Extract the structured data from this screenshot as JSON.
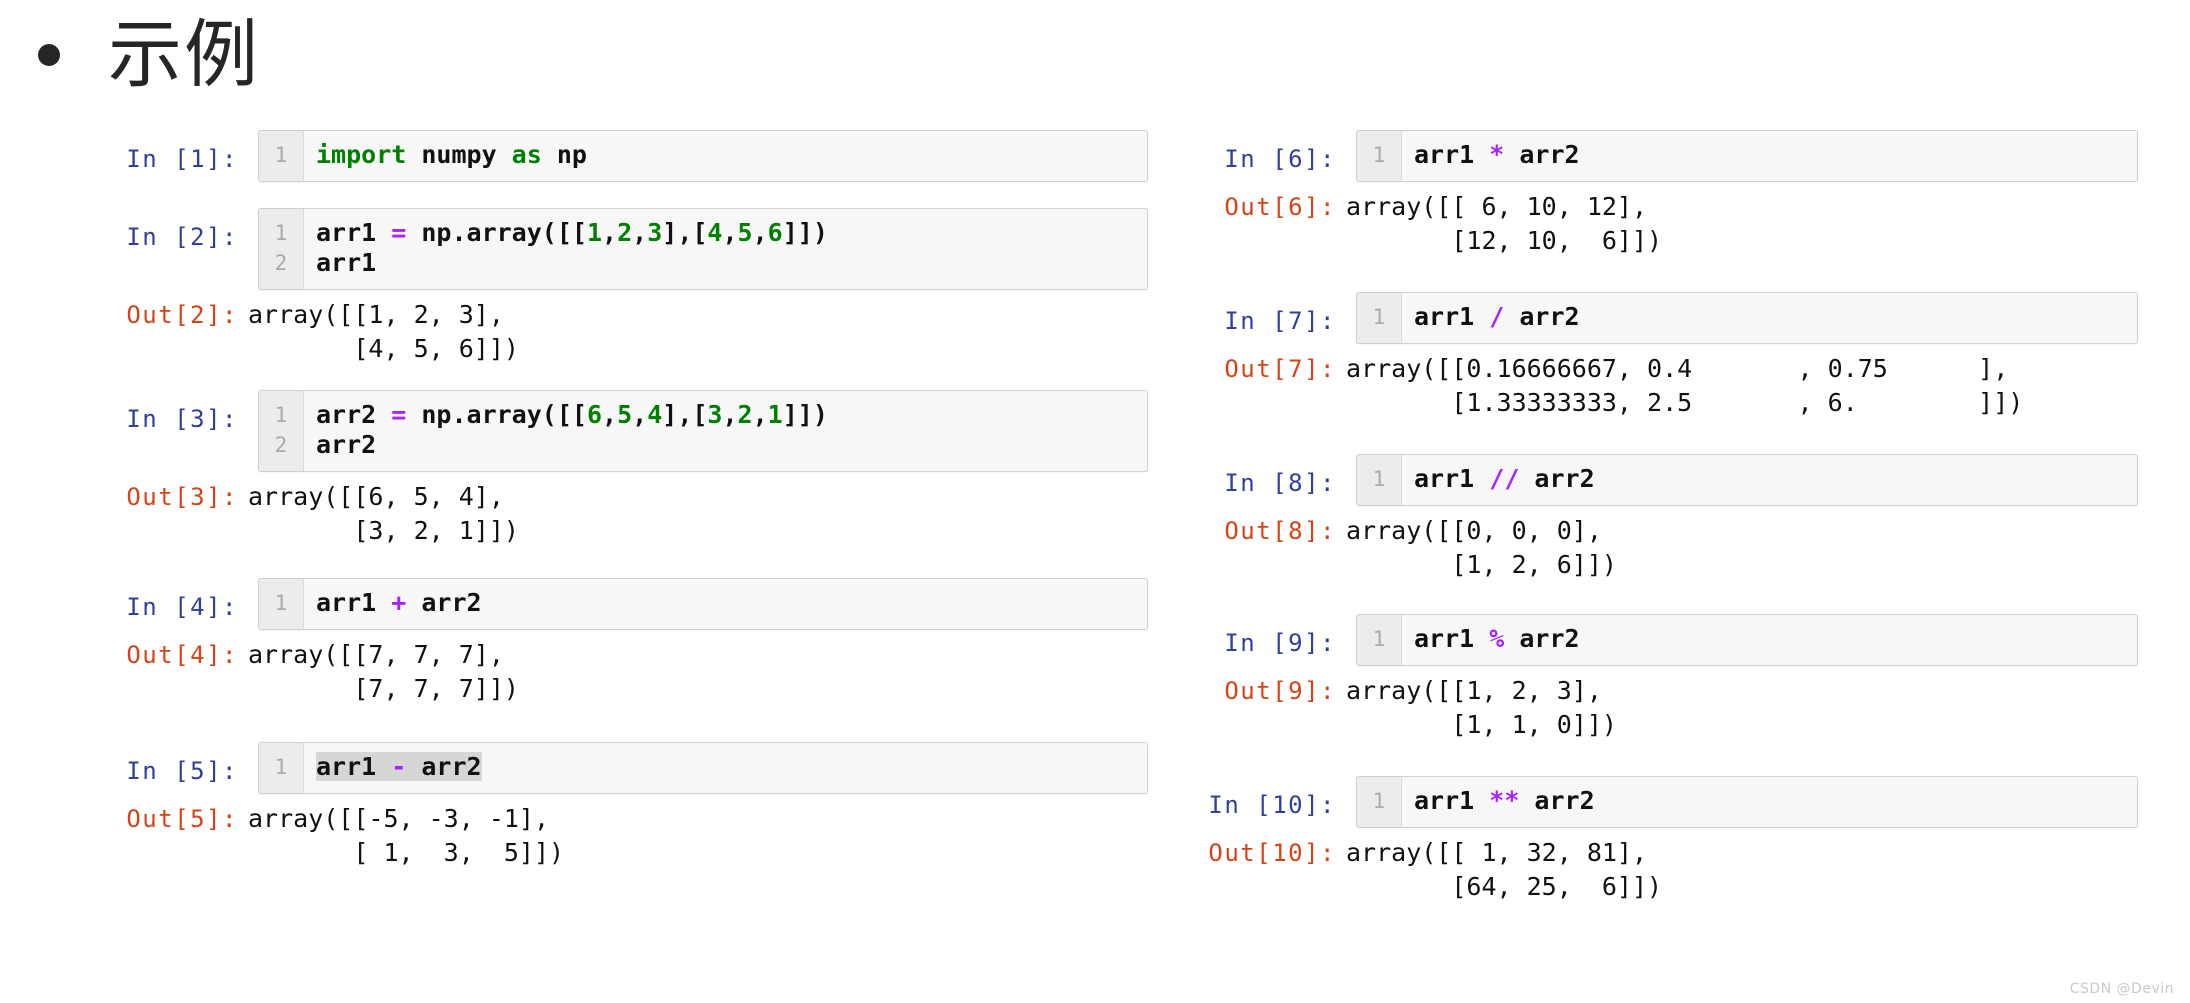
{
  "slide": {
    "bullet_glyph": "•",
    "title": "示例",
    "watermark": "CSDN @Devin"
  },
  "left_column": [
    {
      "in_prompt": "In [1]:",
      "line_numbers": "1",
      "code_tokens": [
        [
          {
            "t": "import",
            "c": "kw"
          },
          {
            "t": " numpy ",
            "c": ""
          },
          {
            "t": "as",
            "c": "kw"
          },
          {
            "t": " np",
            "c": ""
          }
        ]
      ],
      "out_prompt": null,
      "out_text": null
    },
    {
      "in_prompt": "In [2]:",
      "line_numbers": "1\n2",
      "code_tokens": [
        [
          {
            "t": "arr1 ",
            "c": ""
          },
          {
            "t": "=",
            "c": "op"
          },
          {
            "t": " np.array([[",
            "c": ""
          },
          {
            "t": "1",
            "c": "num"
          },
          {
            "t": ",",
            "c": ""
          },
          {
            "t": "2",
            "c": "num"
          },
          {
            "t": ",",
            "c": ""
          },
          {
            "t": "3",
            "c": "num"
          },
          {
            "t": "],[",
            "c": ""
          },
          {
            "t": "4",
            "c": "num"
          },
          {
            "t": ",",
            "c": ""
          },
          {
            "t": "5",
            "c": "num"
          },
          {
            "t": ",",
            "c": ""
          },
          {
            "t": "6",
            "c": "num"
          },
          {
            "t": "]])",
            "c": ""
          }
        ],
        [
          {
            "t": "arr1",
            "c": ""
          }
        ]
      ],
      "out_prompt": "Out[2]:",
      "out_text": "array([[1, 2, 3],\n       [4, 5, 6]])"
    },
    {
      "in_prompt": "In [3]:",
      "line_numbers": "1\n2",
      "code_tokens": [
        [
          {
            "t": "arr2 ",
            "c": ""
          },
          {
            "t": "=",
            "c": "op"
          },
          {
            "t": " np.array([[",
            "c": ""
          },
          {
            "t": "6",
            "c": "num"
          },
          {
            "t": ",",
            "c": ""
          },
          {
            "t": "5",
            "c": "num"
          },
          {
            "t": ",",
            "c": ""
          },
          {
            "t": "4",
            "c": "num"
          },
          {
            "t": "],[",
            "c": ""
          },
          {
            "t": "3",
            "c": "num"
          },
          {
            "t": ",",
            "c": ""
          },
          {
            "t": "2",
            "c": "num"
          },
          {
            "t": ",",
            "c": ""
          },
          {
            "t": "1",
            "c": "num"
          },
          {
            "t": "]])",
            "c": ""
          }
        ],
        [
          {
            "t": "arr2",
            "c": ""
          }
        ]
      ],
      "out_prompt": "Out[3]:",
      "out_text": "array([[6, 5, 4],\n       [3, 2, 1]])"
    },
    {
      "in_prompt": "In [4]:",
      "line_numbers": "1",
      "code_tokens": [
        [
          {
            "t": "arr1 ",
            "c": ""
          },
          {
            "t": "+",
            "c": "op"
          },
          {
            "t": " arr2",
            "c": ""
          }
        ]
      ],
      "out_prompt": "Out[4]:",
      "out_text": "array([[7, 7, 7],\n       [7, 7, 7]])"
    },
    {
      "in_prompt": "In [5]:",
      "line_numbers": "1",
      "code_tokens": [
        [
          {
            "t": "arr1 ",
            "c": "sel"
          },
          {
            "t": "-",
            "c": "op sel"
          },
          {
            "t": " arr2",
            "c": "sel"
          }
        ]
      ],
      "out_prompt": "Out[5]:",
      "out_text": "array([[-5, -3, -1],\n       [ 1,  3,  5]])"
    }
  ],
  "right_column": [
    {
      "in_prompt": "In [6]:",
      "line_numbers": "1",
      "code_tokens": [
        [
          {
            "t": "arr1 ",
            "c": ""
          },
          {
            "t": "*",
            "c": "op"
          },
          {
            "t": " arr2",
            "c": ""
          }
        ]
      ],
      "out_prompt": "Out[6]:",
      "out_text": "array([[ 6, 10, 12],\n       [12, 10,  6]])"
    },
    {
      "in_prompt": "In [7]:",
      "line_numbers": "1",
      "code_tokens": [
        [
          {
            "t": "arr1 ",
            "c": ""
          },
          {
            "t": "/",
            "c": "op"
          },
          {
            "t": " arr2",
            "c": ""
          }
        ]
      ],
      "out_prompt": "Out[7]:",
      "out_text": "array([[0.16666667, 0.4       , 0.75      ],\n       [1.33333333, 2.5       , 6.        ]])"
    },
    {
      "in_prompt": "In [8]:",
      "line_numbers": "1",
      "code_tokens": [
        [
          {
            "t": "arr1 ",
            "c": ""
          },
          {
            "t": "//",
            "c": "op"
          },
          {
            "t": " arr2",
            "c": ""
          }
        ]
      ],
      "out_prompt": "Out[8]:",
      "out_text": "array([[0, 0, 0],\n       [1, 2, 6]])"
    },
    {
      "in_prompt": "In [9]:",
      "line_numbers": "1",
      "code_tokens": [
        [
          {
            "t": "arr1 ",
            "c": ""
          },
          {
            "t": "%",
            "c": "op"
          },
          {
            "t": " arr2",
            "c": ""
          }
        ]
      ],
      "out_prompt": "Out[9]:",
      "out_text": "array([[1, 2, 3],\n       [1, 1, 0]])"
    },
    {
      "in_prompt": "In [10]:",
      "line_numbers": "1",
      "code_tokens": [
        [
          {
            "t": "arr1 ",
            "c": ""
          },
          {
            "t": "**",
            "c": "op"
          },
          {
            "t": " arr2",
            "c": ""
          }
        ]
      ],
      "out_prompt": "Out[10]:",
      "out_text": "array([[ 1, 32, 81],\n       [64, 25,  6]])"
    }
  ],
  "colors": {
    "in_prompt": "#303f9f",
    "out_prompt": "#d84315",
    "keyword": "#008000",
    "number": "#008000",
    "operator": "#aa22ff",
    "selection": "#d6d6d6",
    "cell_background": "#f7f7f7",
    "cell_border": "#cfcfcf",
    "gutter_background": "#ececec"
  }
}
